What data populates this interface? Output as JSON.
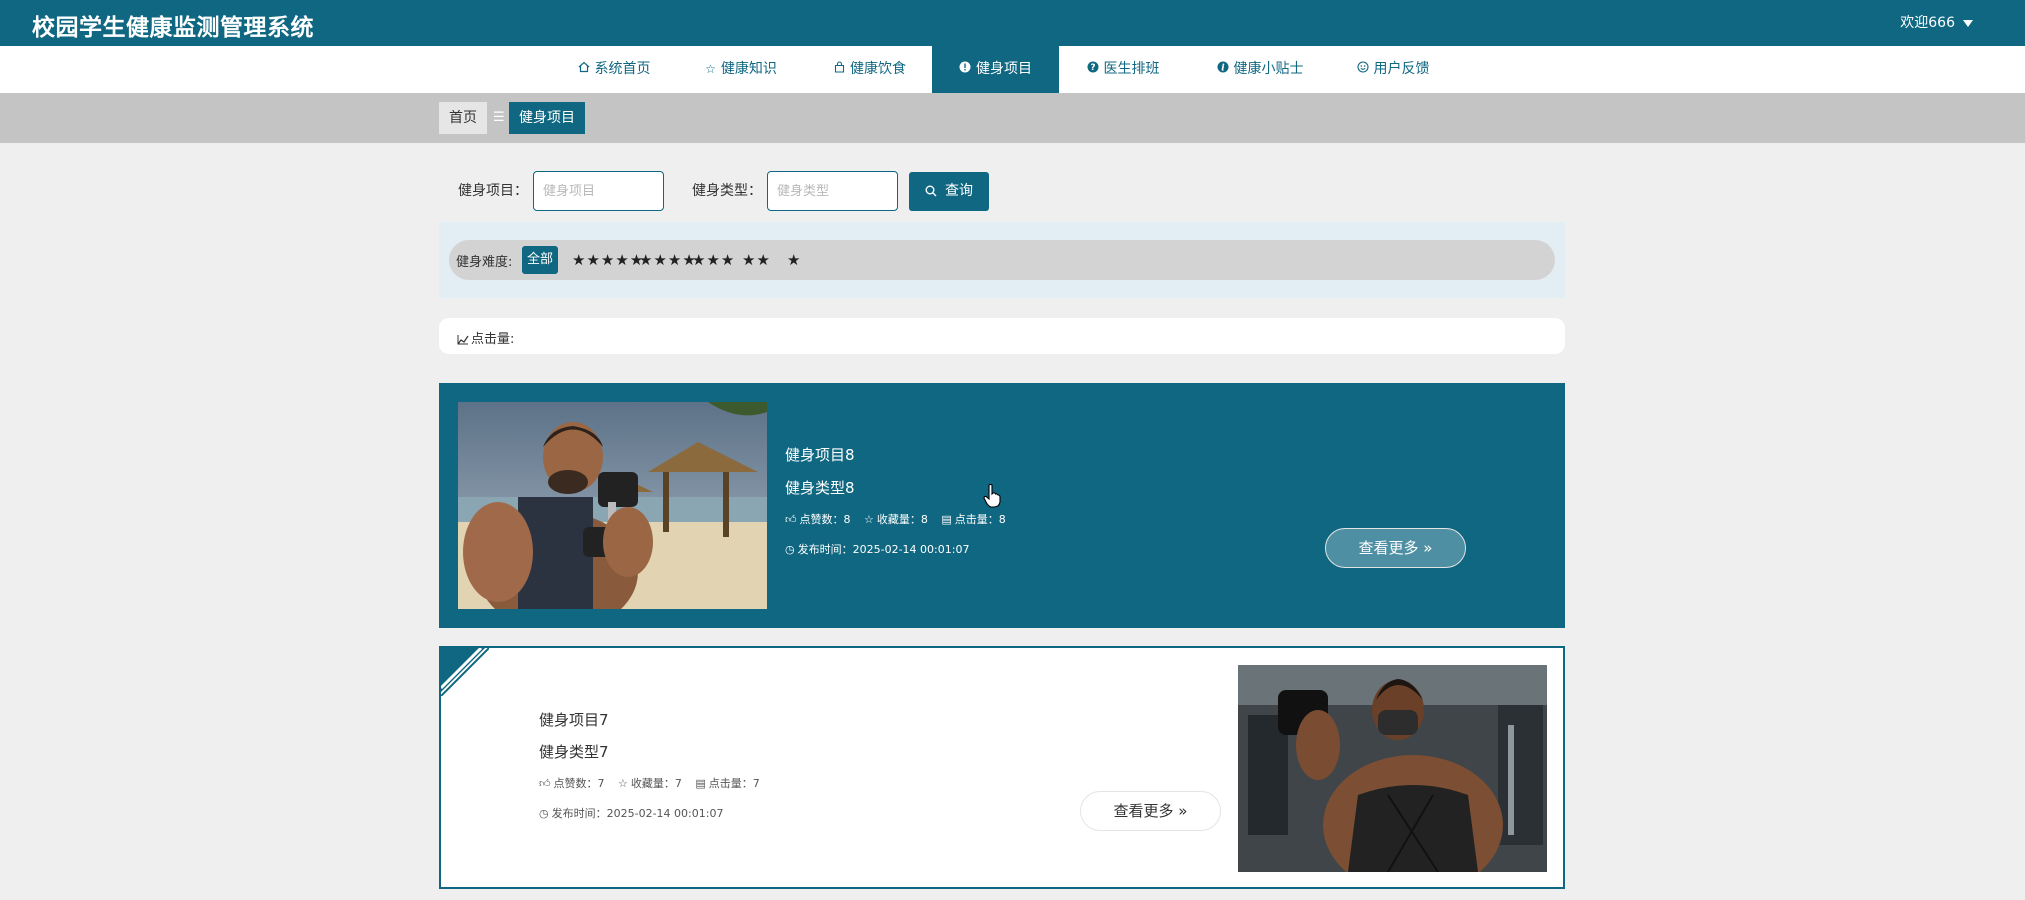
{
  "app": {
    "title": "校园学生健康监测管理系统",
    "welcome": "欢迎666"
  },
  "nav": {
    "items": [
      {
        "label": "系统首页",
        "icon": "home-icon"
      },
      {
        "label": "健康知识",
        "icon": "star-icon"
      },
      {
        "label": "健康饮食",
        "icon": "bag-icon"
      },
      {
        "label": "健身项目",
        "icon": "info-icon",
        "active": true
      },
      {
        "label": "医生排班",
        "icon": "question-icon"
      },
      {
        "label": "健康小贴士",
        "icon": "info-icon"
      },
      {
        "label": "用户反馈",
        "icon": "smile-icon"
      }
    ]
  },
  "breadcrumb": {
    "home": "首页",
    "separator": "☰",
    "current": "健身项目"
  },
  "search": {
    "project_label": "健身项目：",
    "project_placeholder": "健身项目",
    "type_label": "健身类型：",
    "type_placeholder": "健身类型",
    "button": "查询"
  },
  "filter": {
    "label": "健身难度:",
    "options": [
      "全部",
      "★★★★★",
      "★★★★",
      "★★★",
      "★★",
      "★"
    ]
  },
  "sort": {
    "label": "点击量:"
  },
  "cards": [
    {
      "title": "健身项目8",
      "type": "健身类型8",
      "likes_label": "点赞数：",
      "likes": "8",
      "fav_label": "收藏量：",
      "fav": "8",
      "clicks_label": "点击量：",
      "clicks": "8",
      "date_label": "发布时间：",
      "date": "2025-02-14 00:01:07",
      "more": "查看更多"
    },
    {
      "title": "健身项目7",
      "type": "健身类型7",
      "likes_label": "点赞数：",
      "likes": "7",
      "fav_label": "收藏量：",
      "fav": "7",
      "clicks_label": "点击量：",
      "clicks": "7",
      "date_label": "发布时间：",
      "date": "2025-02-14 00:01:07",
      "more": "查看更多"
    }
  ],
  "colors": {
    "primary": "#106781",
    "page_bg": "#efefef",
    "crumb_bg": "#c4c4c4"
  }
}
